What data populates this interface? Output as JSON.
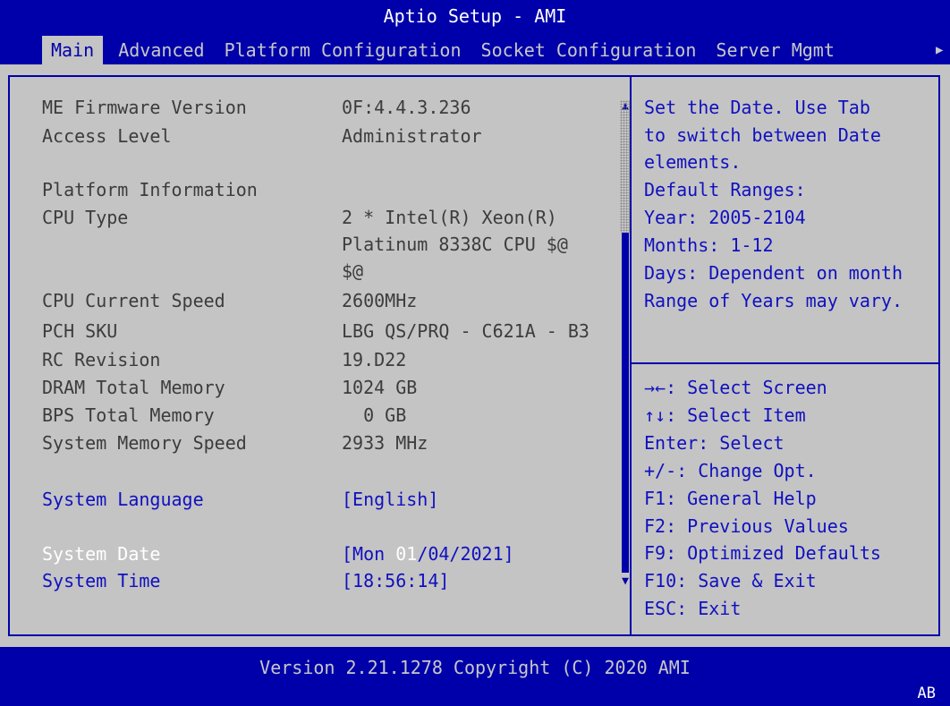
{
  "header": {
    "title": "Aptio Setup - AMI",
    "tabs": [
      "Main",
      "Advanced",
      "Platform Configuration",
      "Socket Configuration",
      "Server Mgmt"
    ],
    "more_arrow": "▶"
  },
  "info": {
    "me_firmware": {
      "label": "ME Firmware Version",
      "value": "0F:4.4.3.236"
    },
    "access_level": {
      "label": "Access Level",
      "value": "Administrator"
    },
    "platform_information": "Platform Information",
    "cpu_type": {
      "label": "CPU Type",
      "value_line1": "2 * Intel(R) Xeon(R)",
      "value_line2": "Platinum 8338C CPU $@",
      "value_line3": "$@"
    },
    "cpu_speed": {
      "label": "CPU Current Speed",
      "value": "2600MHz"
    },
    "pch_sku": {
      "label": "PCH SKU",
      "value": "LBG QS/PRQ - C621A - B3"
    },
    "rc_revision": {
      "label": "RC Revision",
      "value": "19.D22"
    },
    "dram_total": {
      "label": "DRAM Total Memory",
      "value": "1024 GB"
    },
    "bps_total": {
      "label": "BPS Total Memory",
      "value": "  0 GB"
    },
    "mem_speed": {
      "label": "System Memory Speed",
      "value": "2933 MHz"
    }
  },
  "settings": {
    "language": {
      "label": "System Language",
      "value": "[English]"
    },
    "date": {
      "label": "System Date",
      "value_prefix": "[Mon ",
      "value_selected": "01",
      "value_suffix": "/04/2021]"
    },
    "time": {
      "label": "System Time",
      "value": "[18:56:14]"
    }
  },
  "help": [
    "Set the Date. Use Tab",
    "to switch between Date",
    "elements.",
    "Default Ranges:",
    "Year: 2005-2104",
    "Months: 1-12",
    "Days: Dependent on month",
    "Range of Years may vary."
  ],
  "keys": [
    "→←: Select Screen",
    "↑↓: Select Item",
    "Enter: Select",
    "+/-: Change Opt.",
    "F1: General Help",
    "F2: Previous Values",
    "F9: Optimized Defaults",
    "F10: Save & Exit",
    "ESC: Exit"
  ],
  "footer": {
    "version": "Version 2.21.1278 Copyright (C) 2020 AMI",
    "corner": "AB"
  },
  "colors": {
    "bios_blue": "#0000aa",
    "background_gray": "#c4c4c4",
    "highlight_white": "#ffffff"
  }
}
